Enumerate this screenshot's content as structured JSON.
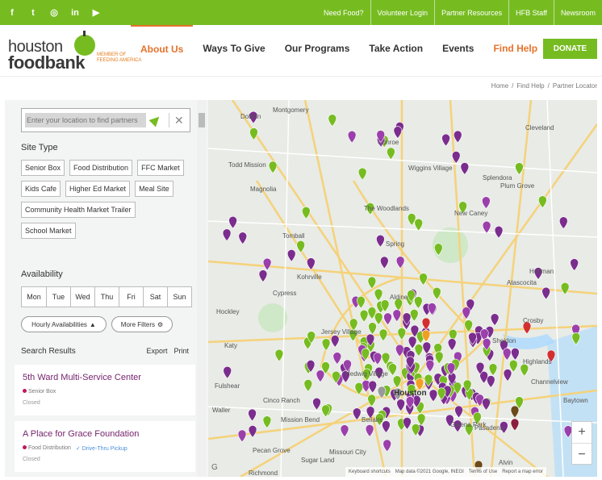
{
  "topbar": {
    "social": [
      {
        "icon": "facebook-icon",
        "glyph": "f"
      },
      {
        "icon": "twitter-icon",
        "glyph": "t"
      },
      {
        "icon": "instagram-icon",
        "glyph": "◎"
      },
      {
        "icon": "linkedin-icon",
        "glyph": "in"
      },
      {
        "icon": "youtube-icon",
        "glyph": "▶"
      }
    ],
    "links": [
      "Need Food?",
      "Volunteer Login",
      "Partner Resources",
      "HFB Staff",
      "Newsroom"
    ]
  },
  "logo": {
    "line1": "houston",
    "line2": "foodbank",
    "partner": "MEMBER OF FEEDING AMERICA"
  },
  "nav": {
    "items": [
      "About Us",
      "Ways To Give",
      "Our Programs",
      "Take Action",
      "Events",
      "Find Help"
    ],
    "donate": "DONATE"
  },
  "breadcrumb": [
    "Home",
    "/",
    "Find Help",
    "/",
    "Partner Locator"
  ],
  "sidebar": {
    "search_placeholder": "Enter your location to find partners",
    "site_type_title": "Site Type",
    "site_types": [
      "Senior Box",
      "Food Distribution",
      "FFC Market",
      "Kids Cafe",
      "Higher Ed Market",
      "Meal Site",
      "Community Health Market Trailer",
      "School Market"
    ],
    "availability_title": "Availability",
    "days": [
      "Mon",
      "Tue",
      "Wed",
      "Thu",
      "Fri",
      "Sat",
      "Sun"
    ],
    "hourly_label": "Hourly Availabilities",
    "more_filters_label": "More Filters",
    "results_title": "Search Results",
    "export_label": "Export",
    "print_label": "Print",
    "results": [
      {
        "name": "5th Ward Multi-Service Center",
        "type": "Senior Box",
        "extra": "",
        "status": "Closed"
      },
      {
        "name": "A Place for Grace Foundation",
        "type": "Food Distribution",
        "extra": "Drive-Thru Pickup",
        "status": "Closed"
      }
    ]
  },
  "map": {
    "labels": [
      "Montgomery",
      "Dobbin",
      "Cleveland",
      "Todd Mission",
      "Wiggins Village",
      "Splendora",
      "Plum Grove",
      "Magnolia",
      "The Woodlands",
      "New Caney",
      "Tomball",
      "Spring",
      "Kohrville",
      "Huffman",
      "Atascocita",
      "Cypress",
      "Crosby",
      "Jersey Village",
      "Katy",
      "Highlands",
      "Channelview",
      "Cinco Ranch",
      "Houston",
      "Pasadena",
      "Mission Bend",
      "Baytown",
      "Pecan Grove",
      "Missouri City",
      "Sugar Land",
      "Richmond",
      "Fulshear",
      "Sheldon",
      "Galena Park",
      "Hockley",
      "Waller",
      "Hedwig Village",
      "Aldine",
      "Conroe",
      "Bellaire",
      "Alvin"
    ],
    "zoom_in": "+",
    "zoom_out": "−",
    "attribution": [
      "Keyboard shortcuts",
      "Map data ©2021 Google, INEGI",
      "Terms of Use",
      "Report a map error"
    ],
    "google": "G"
  },
  "colors": {
    "green": "#76bc21",
    "orange": "#e5722b",
    "purple": "#7b2d8e",
    "red": "#c2185b"
  }
}
